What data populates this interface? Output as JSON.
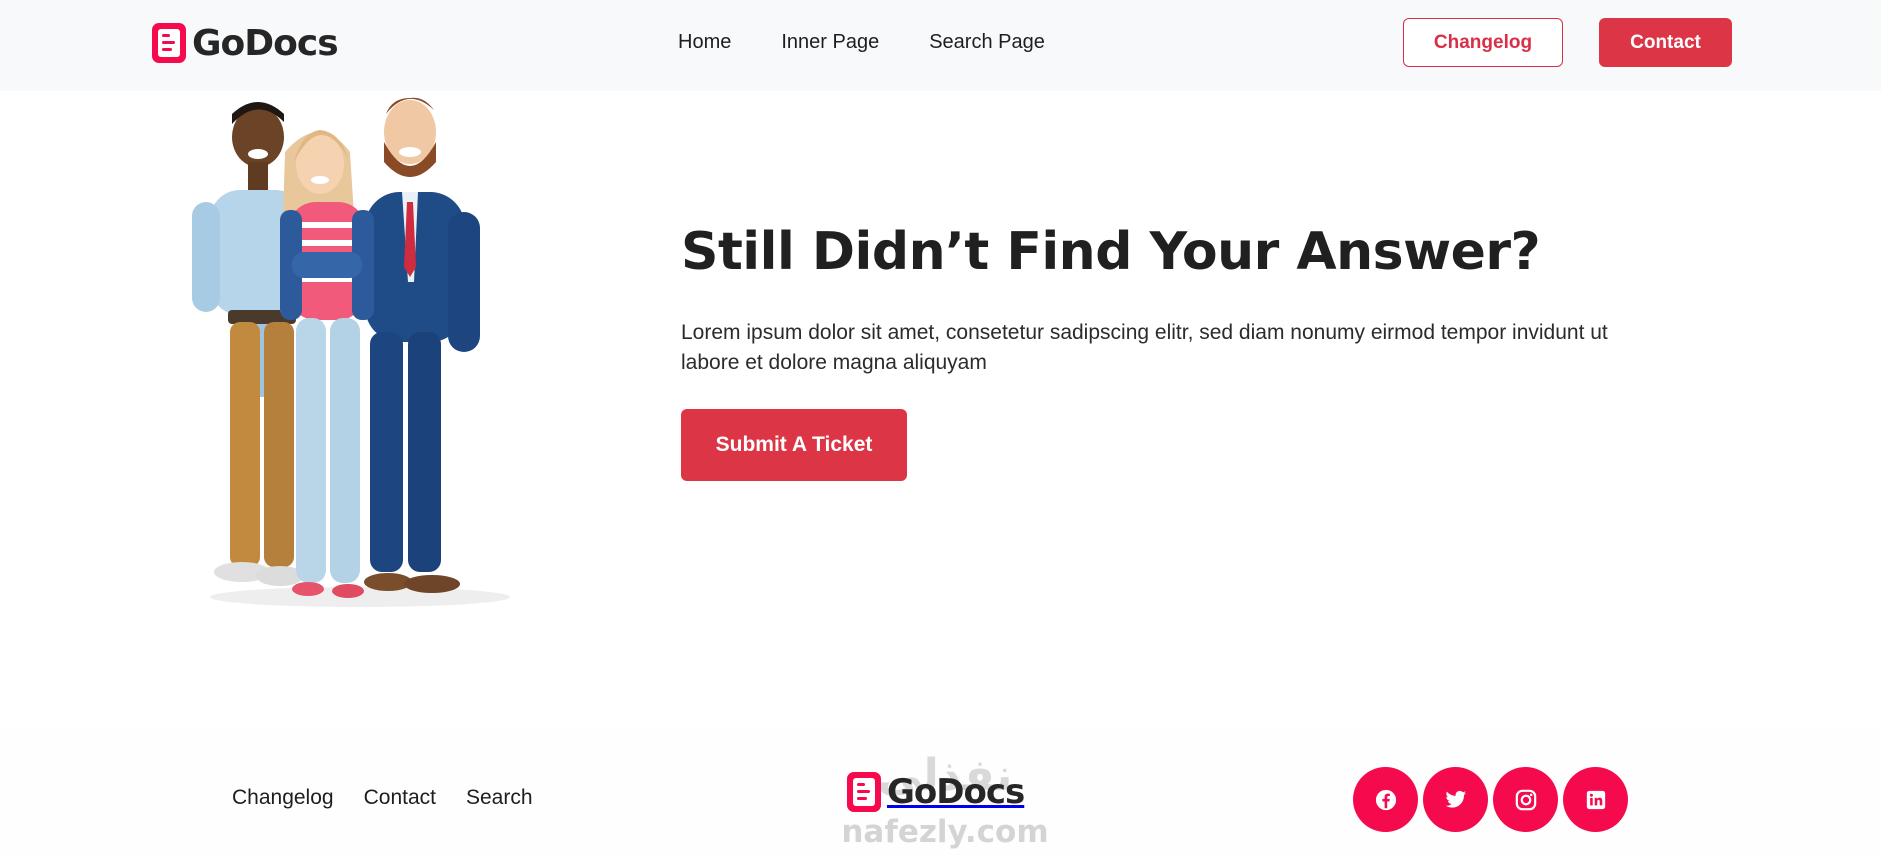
{
  "brand": {
    "name": "GoDocs",
    "accent": "#dc3546",
    "logo_icon": "document-icon"
  },
  "header": {
    "nav": [
      "Home",
      "Inner Page",
      "Search Page"
    ],
    "changelog_label": "Changelog",
    "contact_label": "Contact"
  },
  "hero": {
    "title": "Still Didn’t Find Your Answer?",
    "text": "Lorem ipsum dolor sit amet, consetetur sadipscing elitr, sed diam nonumy eirmod tempor invidunt ut labore et dolore magna aliquyam",
    "button_label": "Submit A Ticket",
    "illustration": "three-people-illustration"
  },
  "footer": {
    "links": [
      "Changelog",
      "Contact",
      "Search"
    ],
    "brand": "GoDocs",
    "watermark_top": "نفذلي",
    "watermark_bottom": "nafezly.com",
    "socials": [
      {
        "name": "facebook-icon"
      },
      {
        "name": "twitter-icon"
      },
      {
        "name": "instagram-icon"
      },
      {
        "name": "linkedin-icon"
      }
    ],
    "social_color": "#f50a4e"
  }
}
